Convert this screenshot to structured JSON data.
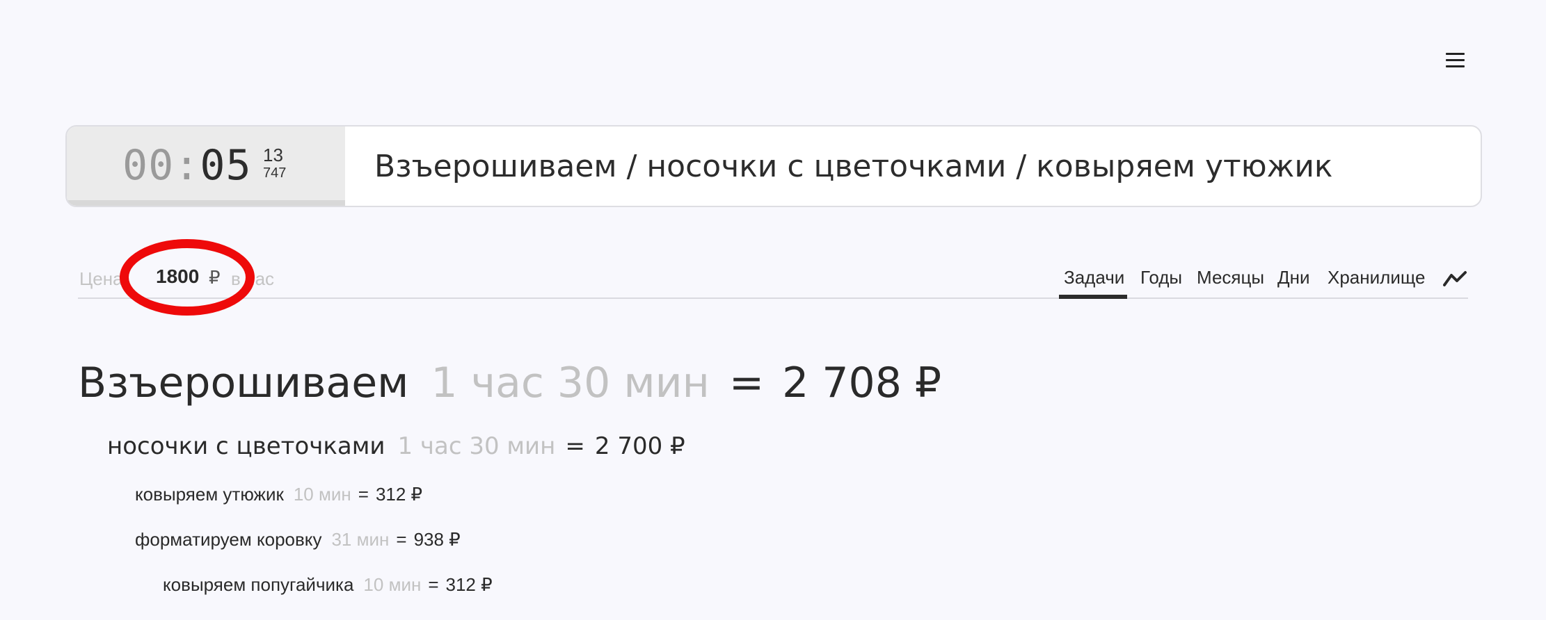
{
  "header": {
    "menu_icon": "hamburger-menu-icon"
  },
  "timer": {
    "hours": "00",
    "separator": ":",
    "minutes": "05",
    "seconds": "13",
    "milliseconds": "747"
  },
  "task_input": {
    "value": "Взъерошиваем / носочки с цветочками / ковыряем утюжик"
  },
  "price": {
    "label": "Цена",
    "value": "1800",
    "currency": "₽",
    "unit": "в час",
    "highlight_color": "#ee0a0a"
  },
  "tabs": [
    {
      "label": "Задачи",
      "active": true
    },
    {
      "label": "Годы"
    },
    {
      "label": "Месяцы"
    },
    {
      "label": "Дни"
    },
    {
      "label": "Хранилище"
    }
  ],
  "trend_icon": "trend-chart-icon",
  "report": [
    {
      "name": "Взъерошиваем",
      "duration": "1 час 30 мин",
      "eq": "=",
      "cost": "2 708 ₽",
      "level": 0
    },
    {
      "name": "носочки с цветочками",
      "duration": "1 час 30 мин",
      "eq": "=",
      "cost": "2 700 ₽",
      "level": 1
    },
    {
      "name": "ковыряем утюжик",
      "duration": "10 мин",
      "eq": "=",
      "cost": "312 ₽",
      "level": 2
    },
    {
      "name": "форматируем коровку",
      "duration": "31 мин",
      "eq": "=",
      "cost": "938 ₽",
      "level": 2
    },
    {
      "name": "ковыряем попугайчика",
      "duration": "10 мин",
      "eq": "=",
      "cost": "312 ₽",
      "level": 3
    }
  ]
}
